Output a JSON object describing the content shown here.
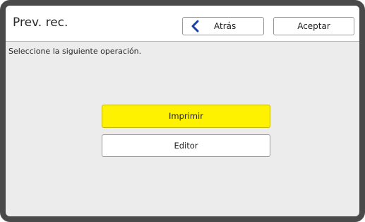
{
  "header": {
    "title": "Prev. rec.",
    "back_label": "Atrás",
    "accept_label": "Aceptar"
  },
  "main": {
    "instruction": "Seleccione la siguiente operación.",
    "primary_label": "Imprimir",
    "secondary_label": "Editor"
  },
  "colors": {
    "primary_button": "#fff200",
    "back_chevron": "#1a3fa6",
    "panel_background": "#ececec",
    "frame": "#4a4a4a"
  },
  "icons": {
    "back": "chevron-left-icon"
  }
}
